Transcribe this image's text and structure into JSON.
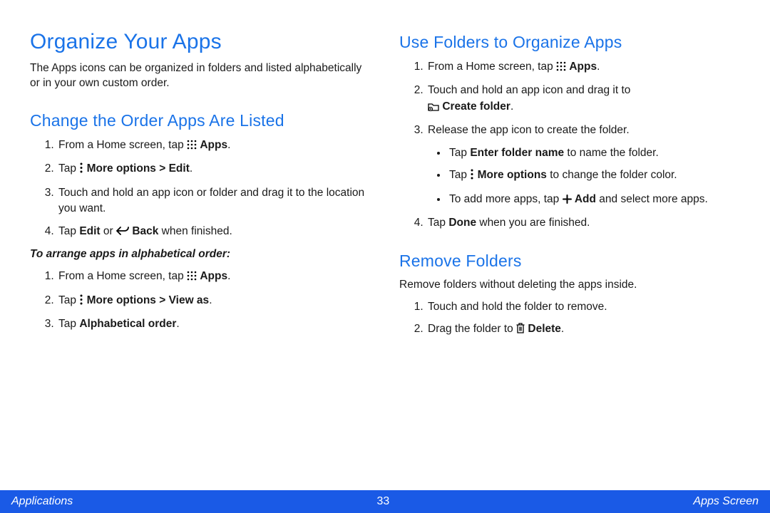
{
  "title": "Organize Your Apps",
  "intro": "The Apps icons can be organized in folders and listed alphabetically or in your own custom order.",
  "left": {
    "h2a": "Change the Order Apps Are Listed",
    "l1a": "From a Home screen, tap ",
    "l1b": "Apps",
    "l2a": "Tap ",
    "l2b": "More options > Edit",
    "l3": "Touch and hold an app icon or folder and drag it to the location you want.",
    "l4a": "Tap ",
    "l4b": "Edit",
    "l4c": " or ",
    "l4d": "Back",
    "l4e": " when finished.",
    "sub": "To arrange apps in alphabetical order:",
    "a1a": "From a Home screen, tap ",
    "a1b": "Apps",
    "a2a": "Tap ",
    "a2b": "More options > View as",
    "a3a": "Tap ",
    "a3b": "Alphabetical order"
  },
  "right": {
    "h2a": "Use Folders to Organize Apps",
    "r1a": "From a Home screen, tap ",
    "r1b": "Apps",
    "r2a": "Touch and hold an app icon and drag it to ",
    "r2b": "Create folder",
    "r3": "Release the app icon to create the folder.",
    "b1a": "Tap ",
    "b1b": "Enter folder name",
    "b1c": " to name the folder.",
    "b2a": "Tap ",
    "b2b": "More options",
    "b2c": " to change the folder color.",
    "b3a": "To add more apps, tap ",
    "b3b": "Add",
    "b3c": " and select more apps.",
    "r4a": "Tap ",
    "r4b": "Done",
    "r4c": " when you are finished.",
    "h2b": "Remove Folders",
    "rfintro": "Remove folders without deleting the apps inside.",
    "rf1": "Touch and hold the folder to remove.",
    "rf2a": "Drag the folder to ",
    "rf2b": "Delete"
  },
  "footer": {
    "left": "Applications",
    "center": "33",
    "right": "Apps Screen"
  }
}
